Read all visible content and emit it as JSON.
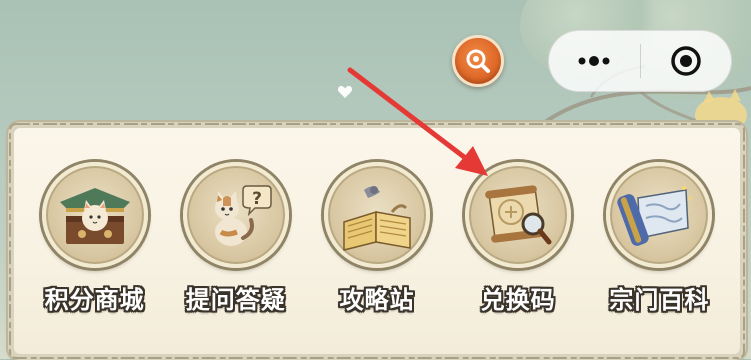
{
  "menu": {
    "items": [
      {
        "id": "points-mall",
        "label": "积分商城",
        "icon": "cat-shop-icon"
      },
      {
        "id": "qa",
        "label": "提问答疑",
        "icon": "cat-question-icon"
      },
      {
        "id": "guides",
        "label": "攻略站",
        "icon": "book-icon"
      },
      {
        "id": "redeem",
        "label": "兑换码",
        "icon": "scroll-magnifier-icon"
      },
      {
        "id": "encyclopedia",
        "label": "宗门百科",
        "icon": "scroll-map-icon"
      }
    ]
  },
  "capsule": {
    "more_icon": "more-dots-icon",
    "close_icon": "target-close-icon"
  },
  "floating": {
    "search_icon": "magnifier-icon"
  },
  "annotation": {
    "arrow_color": "#e53935",
    "points_to": "redeem"
  },
  "colors": {
    "panel_bg": "#f8f2e3",
    "medallion_ring": "#8f8466",
    "accent_orange": "#e06a2a"
  }
}
